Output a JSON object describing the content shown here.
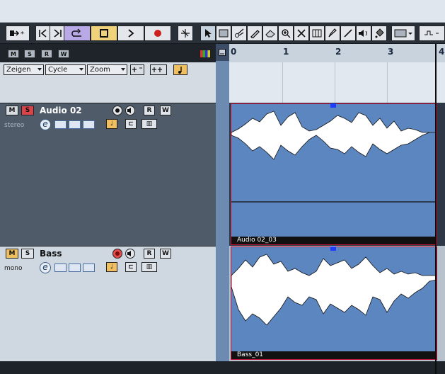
{
  "toolbar": {
    "buttons": [
      {
        "name": "automation-icon"
      },
      {
        "name": "go-to-start-icon"
      },
      {
        "name": "go-to-end-icon"
      },
      {
        "name": "cycle-icon"
      },
      {
        "name": "stop-icon"
      },
      {
        "name": "play-icon"
      },
      {
        "name": "record-icon"
      },
      {
        "name": "snap-icon"
      },
      {
        "name": "pointer-tool-icon"
      },
      {
        "name": "range-tool-icon"
      },
      {
        "name": "split-tool-icon"
      },
      {
        "name": "glue-tool-icon"
      },
      {
        "name": "erase-tool-icon"
      },
      {
        "name": "zoom-tool-icon"
      },
      {
        "name": "mute-tool-icon"
      },
      {
        "name": "comp-tool-icon"
      },
      {
        "name": "draw-tool-icon"
      },
      {
        "name": "line-tool-icon"
      },
      {
        "name": "speaker-tool-icon"
      },
      {
        "name": "color-tool-icon"
      },
      {
        "name": "color-select-icon"
      },
      {
        "name": "snap-type-icon"
      }
    ]
  },
  "filter_modes": [
    "M",
    "S",
    "R",
    "W"
  ],
  "ruler": {
    "bars": [
      "0",
      "1",
      "2",
      "3",
      "4"
    ]
  },
  "filters": {
    "show": "Zeigen",
    "cycle": "Cycle",
    "zoom": "Zoom"
  },
  "tracks": [
    {
      "name": "Audio 02",
      "sub": "stereo",
      "mute": "M",
      "solo": "S",
      "read": "R",
      "write": "W",
      "edit": "e",
      "event_label": "Audio 02_03",
      "solo_active": true
    },
    {
      "name": "Bass",
      "sub": "mono",
      "mute": "M",
      "solo": "S",
      "read": "R",
      "write": "W",
      "edit": "e",
      "event_label": "Bass_01",
      "record_armed": true
    }
  ],
  "colors": {
    "event": "#5b86bf",
    "event_border": "#c2143a",
    "cycle_active": "#b9a9e6",
    "stop_active": "#f0d27a",
    "record": "#cc1f1f"
  }
}
